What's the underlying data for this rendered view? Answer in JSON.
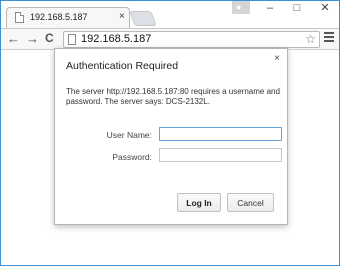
{
  "browser": {
    "tab": {
      "title": "192.168.5.187",
      "close_glyph": "×",
      "icon": "page-icon"
    },
    "window_controls": {
      "minimize": "–",
      "maximize": "□",
      "close": "✕",
      "user_icon": "person-icon"
    },
    "toolbar": {
      "back": "←",
      "forward": "→",
      "reload": "C",
      "url": "192.168.5.187",
      "star_glyph": "☆",
      "menu_icon": "hamburger-menu-icon"
    }
  },
  "dialog": {
    "title": "Authentication Required",
    "close_glyph": "×",
    "message": "The server http://192.168.5.187:80 requires a username and password. The server says: DCS-2132L.",
    "username_label": "User Name:",
    "username_value": "",
    "password_label": "Password:",
    "password_value": "",
    "login_label": "Log In",
    "cancel_label": "Cancel"
  },
  "colors": {
    "frame_accent": "#3f8fd6",
    "focus_border": "#6aa3df"
  }
}
